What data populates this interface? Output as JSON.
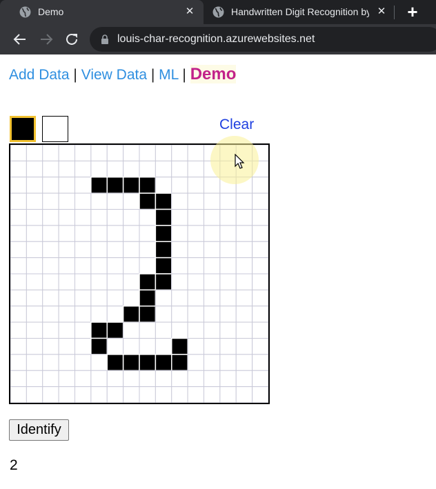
{
  "browser": {
    "tabs": [
      {
        "title": "Demo",
        "icon": "globe-icon",
        "active": true
      },
      {
        "title": "Handwritten Digit Recognition by",
        "icon": "globe-icon",
        "active": false
      }
    ],
    "close_glyph": "✕",
    "new_tab_glyph": "+",
    "url": "louis-char-recognition.azurewebsites.net"
  },
  "nav": {
    "links": [
      "Add Data",
      "View Data",
      "ML"
    ],
    "separator": " | ",
    "current": "Demo"
  },
  "palette": {
    "selected_color": "#000000",
    "colors": [
      "#000000",
      "#ffffff"
    ],
    "clear_label": "Clear"
  },
  "canvas": {
    "rows": 16,
    "cols": 16,
    "filled_cells": [
      [
        2,
        5
      ],
      [
        2,
        6
      ],
      [
        2,
        7
      ],
      [
        2,
        8
      ],
      [
        3,
        8
      ],
      [
        3,
        9
      ],
      [
        4,
        9
      ],
      [
        5,
        9
      ],
      [
        6,
        9
      ],
      [
        7,
        9
      ],
      [
        8,
        8
      ],
      [
        8,
        9
      ],
      [
        9,
        8
      ],
      [
        10,
        7
      ],
      [
        10,
        8
      ],
      [
        11,
        5
      ],
      [
        11,
        6
      ],
      [
        12,
        5
      ],
      [
        12,
        10
      ],
      [
        13,
        6
      ],
      [
        13,
        7
      ],
      [
        13,
        8
      ],
      [
        13,
        9
      ],
      [
        13,
        10
      ]
    ]
  },
  "identify_label": "Identify",
  "result": "2"
}
